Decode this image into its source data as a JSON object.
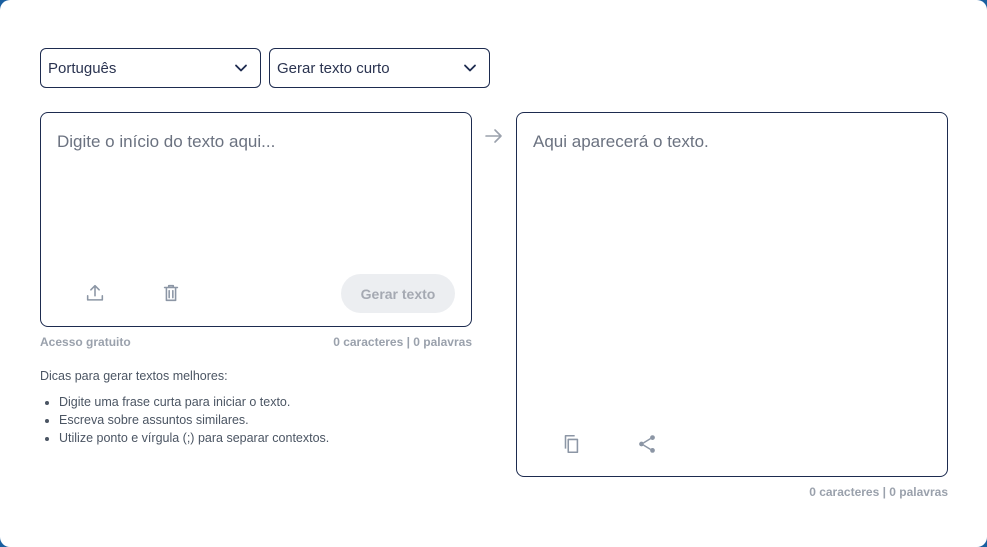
{
  "selects": {
    "language": "Português",
    "mode": "Gerar texto curto"
  },
  "input": {
    "placeholder": "Digite o início do texto aqui...",
    "generate_label": "Gerar texto",
    "access_label": "Acesso gratuito",
    "counter": "0 caracteres | 0 palavras"
  },
  "tips": {
    "title": "Dicas para gerar textos melhores:",
    "items": [
      "Digite uma frase curta para iniciar o texto.",
      "Escreva sobre assuntos similares.",
      "Utilize ponto e vírgula (;) para separar contextos."
    ]
  },
  "output": {
    "placeholder": "Aqui aparecerá o texto.",
    "counter": "0 caracteres | 0 palavras"
  },
  "icons": {
    "language_chevron": "chevron-down-icon",
    "mode_chevron": "chevron-down-icon",
    "arrow": "arrow-right-icon",
    "upload": "upload-icon",
    "delete": "trash-icon",
    "copy": "copy-icon",
    "share": "share-icon"
  }
}
